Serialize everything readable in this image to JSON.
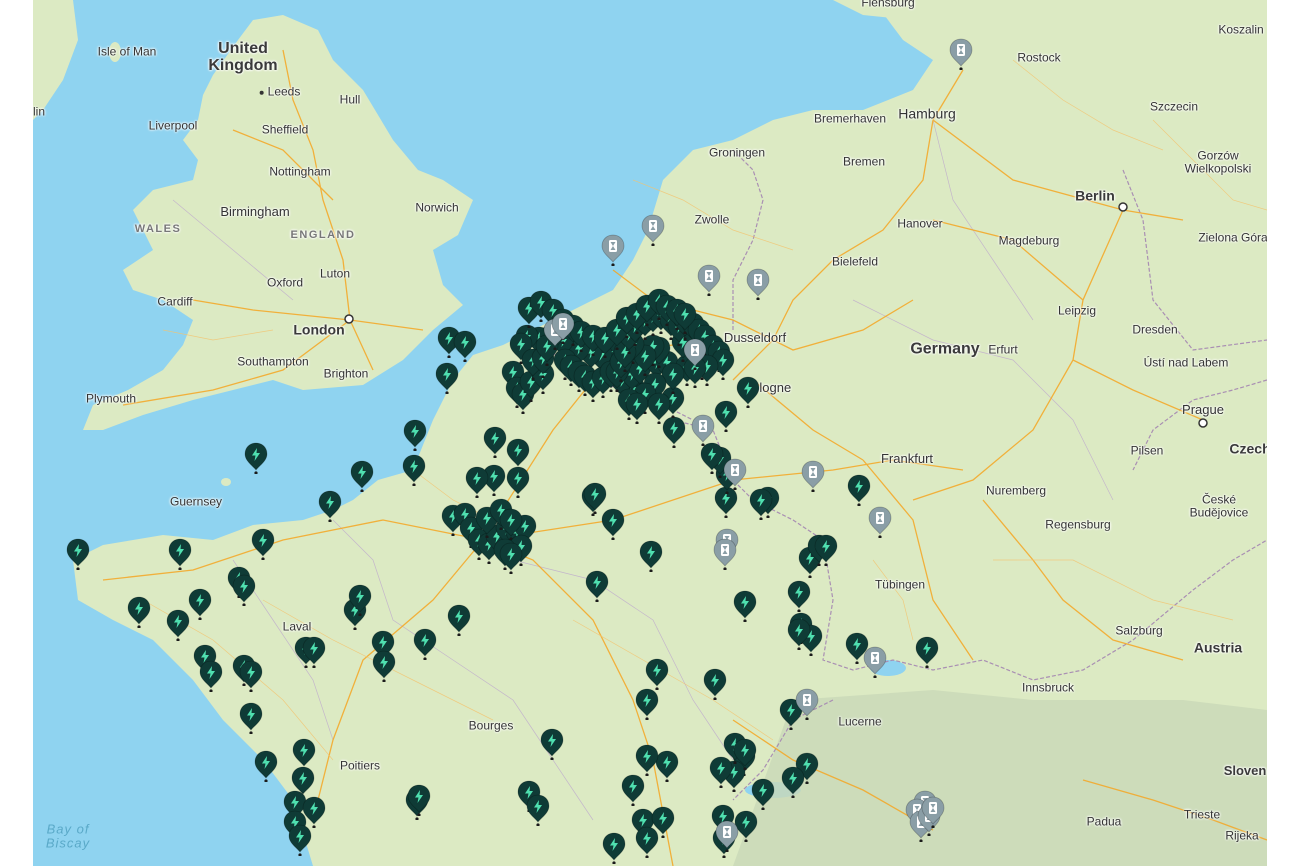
{
  "map": {
    "labels": {
      "isle_of_man": "Isle of Man",
      "united_kingdom": "United\nKingdom",
      "lin": "lin",
      "leeds": "Leeds",
      "hull": "Hull",
      "liverpool": "Liverpool",
      "sheffield": "Sheffield",
      "nottingham": "Nottingham",
      "birmingham": "Birmingham",
      "wales": "WALES",
      "england": "ENGLAND",
      "norwich": "Norwich",
      "luton": "Luton",
      "oxford": "Oxford",
      "cardiff": "Cardiff",
      "london": "London",
      "southampton": "Southampton",
      "brighton": "Brighton",
      "plymouth": "Plymouth",
      "guernsey": "Guernsey",
      "laval": "Laval",
      "bourges": "Bourges",
      "poitiers": "Poitiers",
      "bay_of_biscay": "Bay of\nBiscay",
      "flensburg": "Flensburg",
      "rostock": "Rostock",
      "koszalin": "Koszalin",
      "hamburg": "Hamburg",
      "szczecin": "Szczecin",
      "bremerhaven": "Bremerhaven",
      "groningen": "Groningen",
      "bremen": "Bremen",
      "gorzow": "Gorzów\nWielkopolski",
      "berlin": "Berlin",
      "zwolle": "Zwolle",
      "hanover": "Hanover",
      "magdeburg": "Magdeburg",
      "zielona": "Zielona Góra",
      "bielefeld": "Bielefeld",
      "leipzig": "Leipzig",
      "dusseldorf": "Dusseldorf",
      "dresden": "Dresden",
      "germany": "Germany",
      "erfurt": "Erfurt",
      "usti": "Ústí nad Labem",
      "cologne": "Cologne",
      "prague": "Prague",
      "czech": "Czech",
      "frankfurt": "Frankfurt",
      "pilsen": "Pilsen",
      "nuremberg": "Nuremberg",
      "ceske": "České\nBudějovice",
      "regensburg": "Regensburg",
      "tubingen": "Tübingen",
      "salzburg": "Salzburg",
      "austria": "Austria",
      "innsbruck": "Innsbruck",
      "lucerne": "Lucerne",
      "slovenia": "Sloven",
      "trieste": "Trieste",
      "padua": "Padua",
      "rijeka": "Rijeka"
    },
    "pin_counts": {
      "charger": 190,
      "planned": 22
    },
    "pin_icons": {
      "charger": "lightning-bolt-icon",
      "planned": "hourglass-icon"
    },
    "colors": {
      "sea": "#8fd3f0",
      "land": "#dceac3",
      "charger_pin": "#0f3b36",
      "charger_bolt": "#4fe0b0",
      "planned_pin": "#8a9ea6",
      "road_major": "#f5a623",
      "border": "#a98fb3"
    }
  }
}
